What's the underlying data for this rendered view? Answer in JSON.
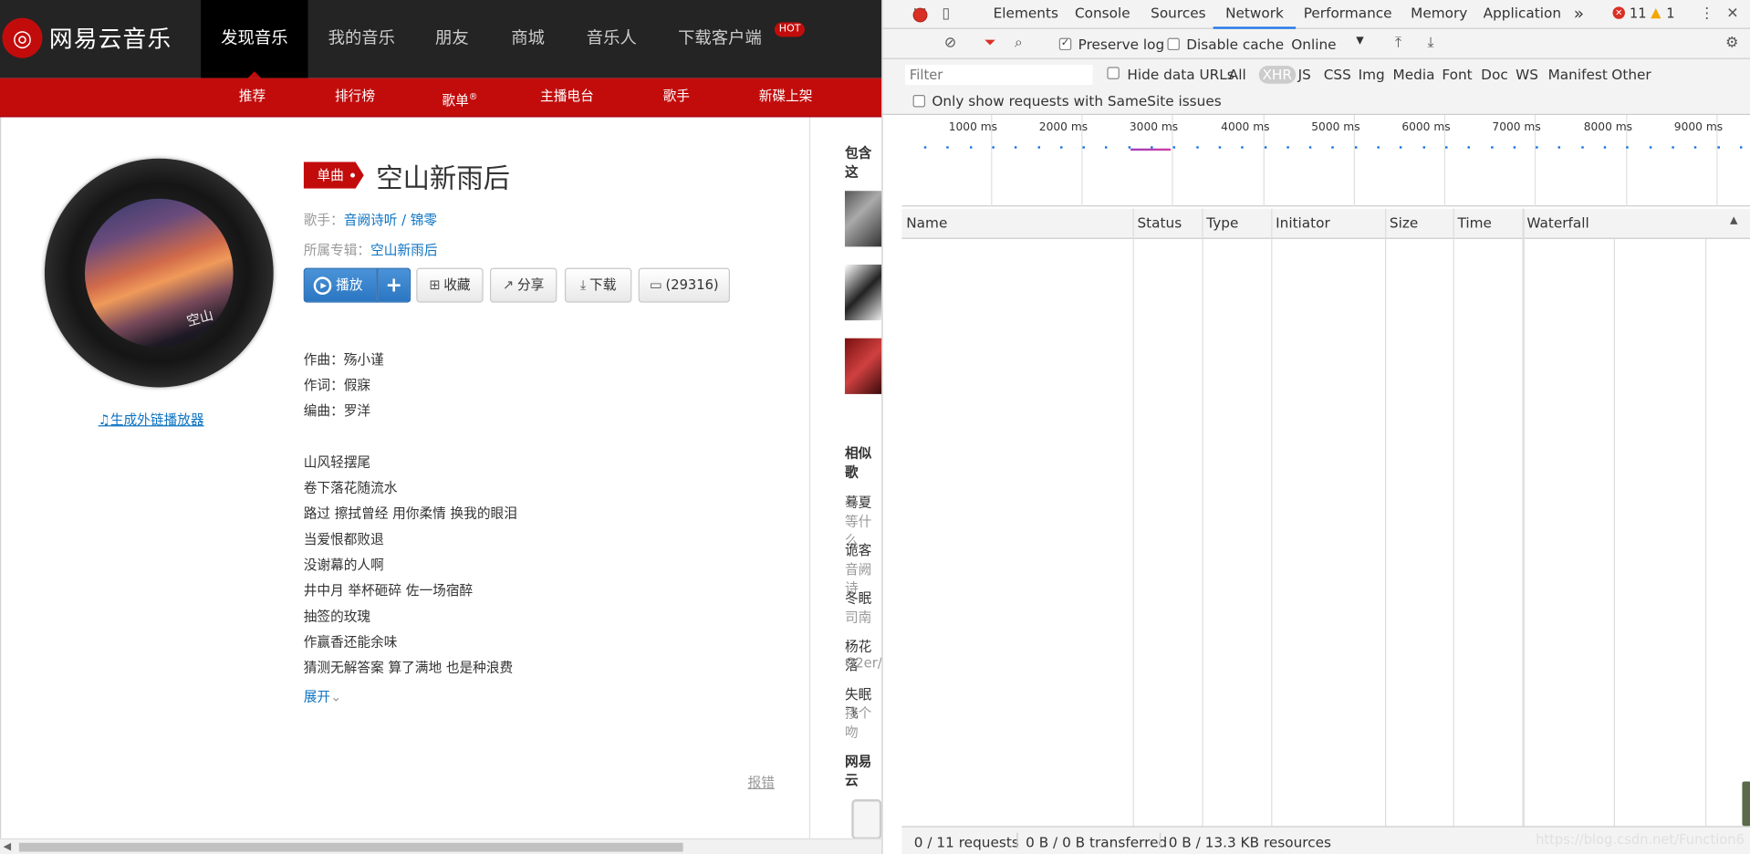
{
  "site": {
    "logo_text": "网易云音乐",
    "nav": [
      "发现音乐",
      "我的音乐",
      "朋友",
      "商城",
      "音乐人",
      "下载客户端"
    ],
    "hot_badge": "HOT",
    "subnav": [
      "推荐",
      "排行榜",
      "歌单",
      "主播电台",
      "歌手",
      "新碟上架"
    ],
    "subnav_mark": "®"
  },
  "song": {
    "badge": "单曲",
    "title": "空山新雨后",
    "singer_label": "歌手：",
    "singer": "音阙诗听 / 锦零",
    "album_label": "所属专辑：",
    "album": "空山新雨后",
    "ext_player": "生成外链播放器",
    "buttons": {
      "play": "播放",
      "add": "+",
      "collect": "收藏",
      "share": "分享",
      "download": "下载",
      "comments": "(29316)"
    },
    "credits": [
      "作曲：殇小谨",
      "作词：假寐",
      "编曲：罗洋"
    ],
    "lyrics": [
      "山风轻摆尾",
      "卷下落花随流水",
      "路过 擦拭曾经 用你柔情 换我的眼泪",
      "当爱恨都败退",
      "没谢幕的人啊",
      "井中月 举杯砸碎 佐一场宿醉",
      "抽签的玫瑰",
      "作赢香还能余味",
      "猜测无解答案 算了满地 也是种浪费"
    ],
    "expand": "展开",
    "report": "报错",
    "cover_text": "空山"
  },
  "sidebar": {
    "contains_title": "包含这",
    "similar_title": "相似歌",
    "similar": [
      {
        "name": "蓦夏",
        "artist": "等什么"
      },
      {
        "name": "诡客",
        "artist": "音阙诗"
      },
      {
        "name": "冬眠",
        "artist": "司南"
      },
      {
        "name": "杨花落",
        "artist": "G2er/"
      },
      {
        "name": "失眠飞",
        "artist": "接个吻"
      }
    ],
    "app_title": "网易云"
  },
  "devtools": {
    "tabs": [
      "Elements",
      "Console",
      "Sources",
      "Network",
      "Performance",
      "Memory",
      "Application"
    ],
    "active_tab": "Network",
    "more": "»",
    "errors": "11",
    "warnings": "1",
    "preserve_log": "Preserve log",
    "disable_cache": "Disable cache",
    "throttle": "Online",
    "filter_placeholder": "Filter",
    "hide_data_urls": "Hide data URLs",
    "filter_types": [
      "All",
      "XHR",
      "JS",
      "CSS",
      "Img",
      "Media",
      "Font",
      "Doc",
      "WS",
      "Manifest",
      "Other"
    ],
    "active_filter": "XHR",
    "samesite": "Only show requests with SameSite issues",
    "timeline": [
      "1000 ms",
      "2000 ms",
      "3000 ms",
      "4000 ms",
      "5000 ms",
      "6000 ms",
      "7000 ms",
      "8000 ms",
      "9000 ms"
    ],
    "columns": [
      "Name",
      "Status",
      "Type",
      "Initiator",
      "Size",
      "Time",
      "Waterfall"
    ],
    "status": {
      "requests": "0 / 11 requests",
      "transferred": "0 B / 0 B transferred",
      "resources": "0 B / 13.3 KB resources"
    }
  },
  "watermark": "https://blog.csdn.net/Function6",
  "colors": {
    "brand_red": "#c20c0c",
    "link_blue": "#0c73c2",
    "devtools_accent": "#1a73e8"
  }
}
